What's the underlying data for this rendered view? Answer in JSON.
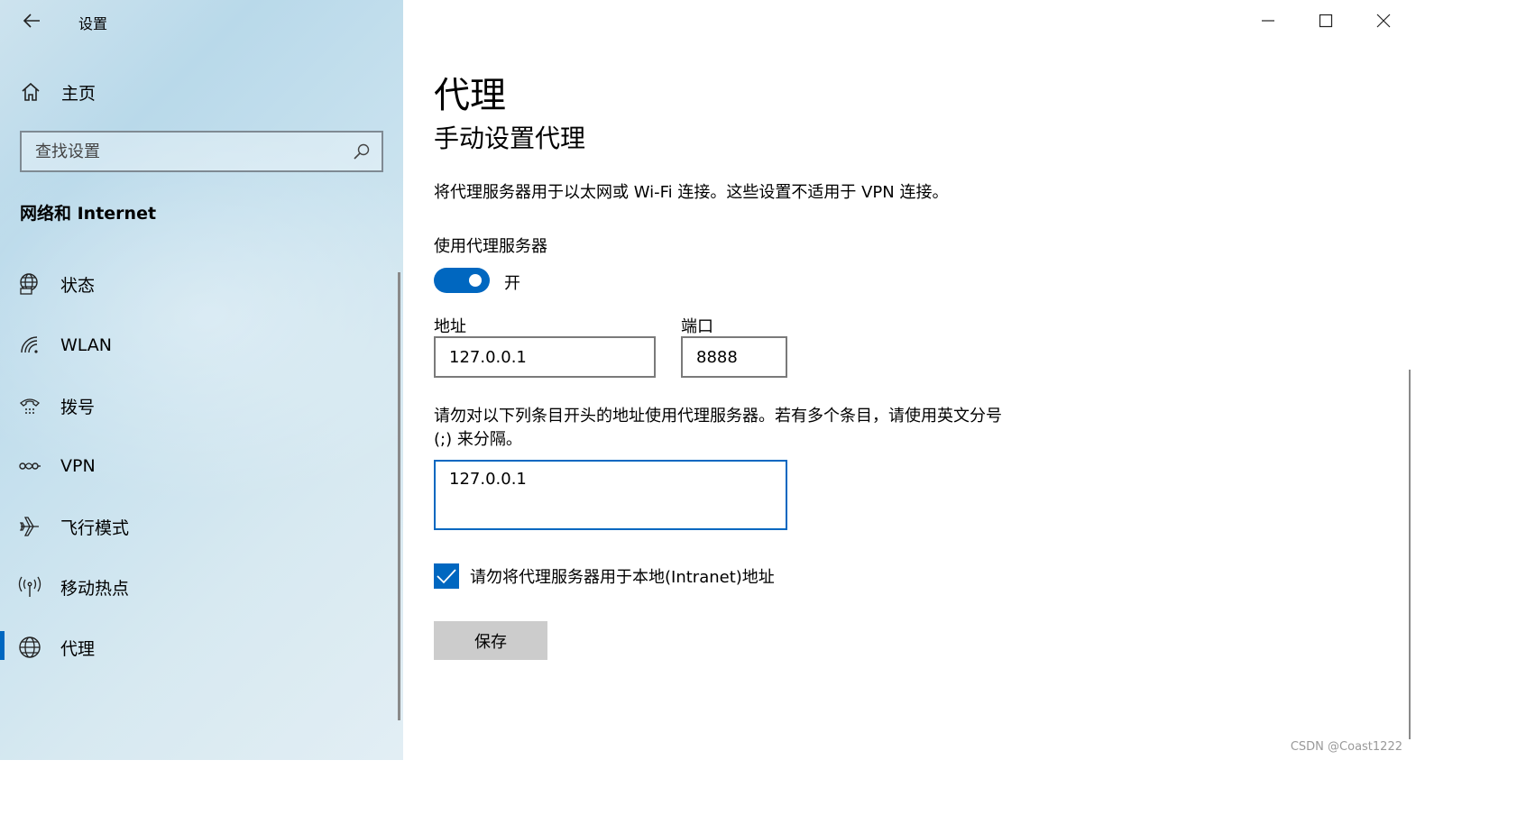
{
  "window": {
    "title": "设置",
    "controls": [
      "minimize",
      "maximize",
      "close"
    ]
  },
  "sidebar": {
    "home_label": "主页",
    "search_placeholder": "查找设置",
    "section_title": "网络和 Internet",
    "items": [
      {
        "label": "状态",
        "icon": "globe-status-icon"
      },
      {
        "label": "WLAN",
        "icon": "wifi-icon"
      },
      {
        "label": "拨号",
        "icon": "dialup-icon"
      },
      {
        "label": "VPN",
        "icon": "vpn-icon"
      },
      {
        "label": "飞行模式",
        "icon": "airplane-icon"
      },
      {
        "label": "移动热点",
        "icon": "hotspot-icon"
      },
      {
        "label": "代理",
        "icon": "globe-icon",
        "active": true
      }
    ]
  },
  "main": {
    "title": "代理",
    "subtitle": "手动设置代理",
    "description": "将代理服务器用于以太网或 Wi-Fi 连接。这些设置不适用于 VPN 连接。",
    "use_proxy_label": "使用代理服务器",
    "toggle_state": "开",
    "toggle_on": true,
    "address_label": "地址",
    "address_value": "127.0.0.1",
    "port_label": "端口",
    "port_value": "8888",
    "bypass_description": "请勿对以下列条目开头的地址使用代理服务器。若有多个条目，请使用英文分号 (;) 来分隔。",
    "bypass_value": "127.0.0.1",
    "local_checkbox_label": "请勿将代理服务器用于本地(Intranet)地址",
    "local_checkbox_checked": true,
    "save_label": "保存"
  },
  "watermark": "CSDN @Coast1222",
  "colors": {
    "accent": "#0067c0",
    "button_gray": "#cccccc"
  }
}
